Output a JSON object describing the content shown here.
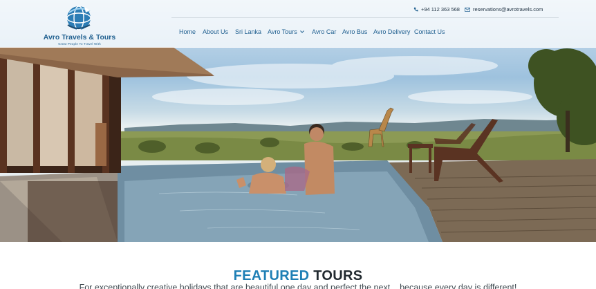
{
  "header": {
    "logo": {
      "title": "Avro Travels & Tours",
      "tagline": "Great People To Travel With"
    },
    "contact": {
      "phone": "+94 112 363 568",
      "email": "reservations@avrotravels.com"
    },
    "nav": [
      {
        "label": "Home"
      },
      {
        "label": "About Us"
      },
      {
        "label": "Sri Lanka"
      },
      {
        "label": "Avro Tours",
        "has_dropdown": true
      },
      {
        "label": "Avro Car"
      },
      {
        "label": "Avro Bus"
      },
      {
        "label": "Avro Delivery"
      },
      {
        "label": "Contact Us"
      }
    ]
  },
  "featured": {
    "title_highlight": "FEATURED",
    "title_rest": "TOURS",
    "subtitle": "For exceptionally creative holidays that are beautiful one day and perfect the next... because every day is different!"
  },
  "colors": {
    "brand_blue": "#1f5f8f",
    "accent_blue": "#1e7fb5",
    "dark_text": "#222a30"
  },
  "icons": {
    "phone": "phone-icon",
    "email": "envelope-icon",
    "dropdown": "chevron-down-icon",
    "logo": "globe-logo-icon"
  }
}
